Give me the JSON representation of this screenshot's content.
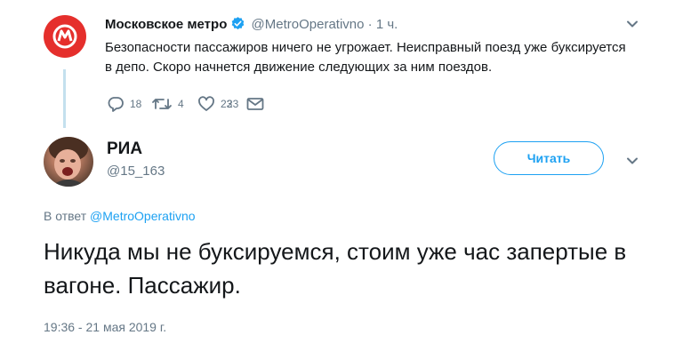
{
  "parent_tweet": {
    "name": "Московское метро",
    "handle": "@MetroOperativno",
    "separator": "·",
    "time": "1 ч.",
    "text": "Безопасности пассажиров ничего не угрожает. Неисправный поезд уже буксируется в депо. Скоро начнется движение следующих за ним поездов.",
    "replies": "18",
    "retweets": "4",
    "likes": "23",
    "avatar_color": "#e52f2c",
    "verified_color": "#1da1f2"
  },
  "reply_tweet": {
    "name": "РИА",
    "handle": "@15_163",
    "follow_label": "Читать",
    "in_reply_prefix": "В ответ",
    "in_reply_handle": "@MetroOperativno",
    "text": "Никуда мы не буксируемся, стоим уже час запертые в вагоне. Пассажир.",
    "timestamp": "19:36 - 21 мая 2019 г."
  },
  "colors": {
    "link": "#1da1f2",
    "muted": "#657786",
    "thread_line": "#c4e0ee"
  }
}
